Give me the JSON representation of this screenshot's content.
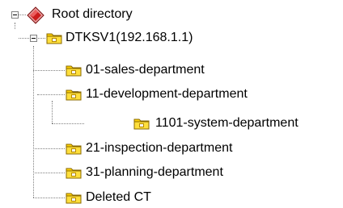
{
  "tree": {
    "nodes": [
      {
        "id": "root",
        "label": "Root directory",
        "icon": "root-diamond-icon",
        "expanded": true,
        "depth": 0
      },
      {
        "id": "server",
        "label": "DTKSV1(192.168.1.1)",
        "icon": "folder-icon",
        "expanded": true,
        "depth": 1
      },
      {
        "id": "sales",
        "label": "01-sales-department",
        "icon": "folder-icon",
        "depth": 2
      },
      {
        "id": "development",
        "label": "11-development-department",
        "icon": "folder-icon",
        "expanded": true,
        "depth": 2
      },
      {
        "id": "system",
        "label": "1101-system-department",
        "icon": "folder-icon",
        "depth": 3
      },
      {
        "id": "inspection",
        "label": "21-inspection-department",
        "icon": "folder-icon",
        "depth": 2
      },
      {
        "id": "planning",
        "label": "31-planning-department",
        "icon": "folder-icon",
        "depth": 2
      },
      {
        "id": "deleted",
        "label": "Deleted CT",
        "icon": "folder-icon",
        "depth": 2
      }
    ]
  },
  "colors": {
    "folder_fill": "#ffd200",
    "folder_shadow": "#b68a00",
    "root_icon_red": "#cc1c1c",
    "tree_line": "#808080"
  }
}
